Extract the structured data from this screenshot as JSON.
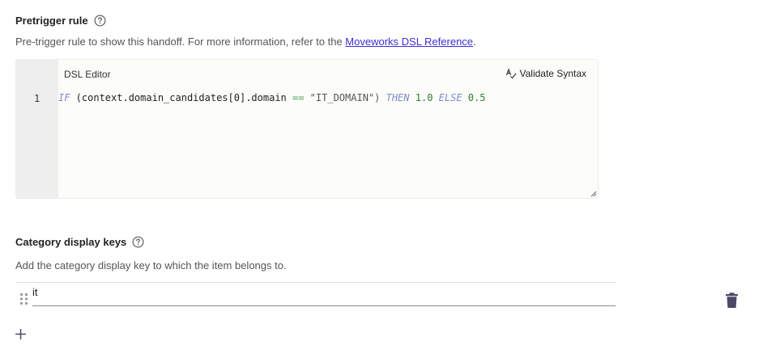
{
  "pretrigger": {
    "title": "Pretrigger rule",
    "description_prefix": "Pre-trigger rule to show this handoff. For more information, refer to the ",
    "link_text": "Moveworks DSL Reference",
    "description_suffix": ".",
    "editor": {
      "label": "DSL Editor",
      "validate_label": "Validate Syntax",
      "line_number": "1",
      "code": {
        "kw_if": "IF",
        "expr": " (context.domain_candidates[0].domain ",
        "op": "==",
        "str": " \"IT_DOMAIN\") ",
        "kw_then": "THEN",
        "num_then": " 1.0 ",
        "kw_else": "ELSE",
        "num_else": " 0.5"
      }
    }
  },
  "category": {
    "title": "Category display keys",
    "description": "Add the category display key to which the item belongs to.",
    "keys": [
      {
        "value": "it"
      }
    ]
  },
  "colors": {
    "link": "#3d2fd6",
    "icon": "#4a4a66"
  },
  "icons": {
    "help": "help-circle-icon",
    "validate": "spellcheck-icon",
    "drag": "drag-handle-icon",
    "delete": "trash-icon",
    "add": "plus-icon"
  }
}
